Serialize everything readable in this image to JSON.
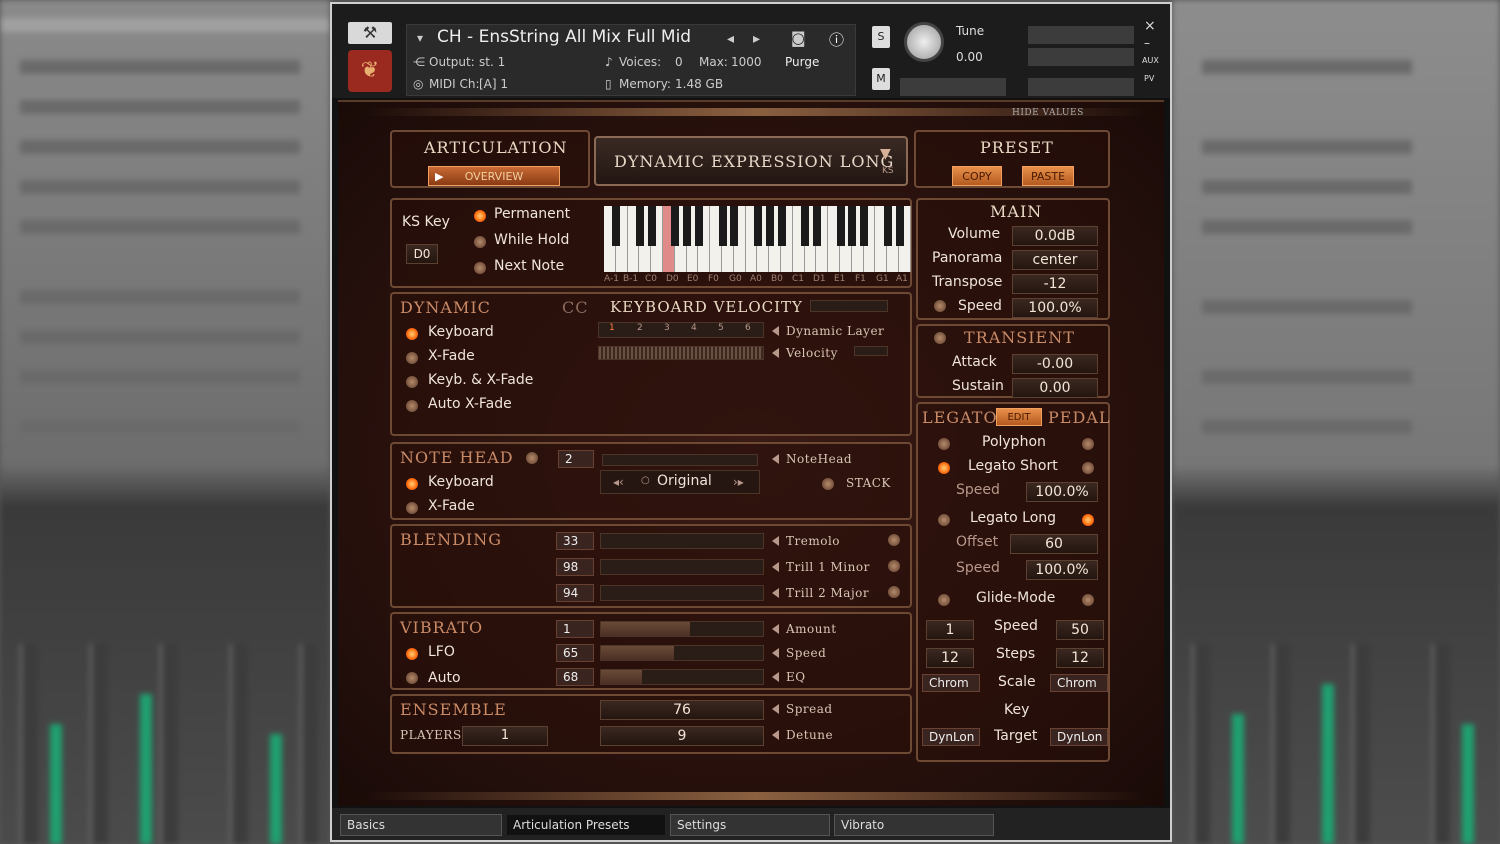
{
  "header": {
    "instrument": "CH - EnsString All Mix Full Mid",
    "output_label": "Output:",
    "output_value": "st. 1",
    "midi_label": "MIDI Ch:",
    "midi_value": "[A]  1",
    "voices_label": "Voices:",
    "voices_value": "0",
    "max_label": "Max:",
    "max_value": "1000",
    "memory_label": "Memory:",
    "memory_value": "1.48 GB",
    "purge": "Purge",
    "tune_label": "Tune",
    "tune_value": "0.00",
    "solo": "S",
    "mute": "M",
    "close": "×",
    "minimize": "–",
    "aux": "AUX",
    "pv": "PV",
    "hide_values": "HIDE VALUES"
  },
  "articulation": {
    "title": "ARTICULATION",
    "overview": "OVERVIEW",
    "current": "DYNAMIC EXPRESSION LONG",
    "ks": "KS"
  },
  "preset": {
    "title": "PRESET",
    "copy": "COPY",
    "paste": "PASTE"
  },
  "ks": {
    "label": "KS Key",
    "key": "D0",
    "modes": [
      "Permanent",
      "While Hold",
      "Next Note"
    ],
    "active": 0
  },
  "keys": {
    "labels": [
      "A-1",
      "B-1",
      "C0",
      "D0",
      "E0",
      "F0",
      "G0",
      "A0",
      "B0",
      "C1",
      "D1",
      "E1",
      "F1",
      "G1",
      "A1"
    ]
  },
  "dynamic": {
    "title": "DYNAMIC",
    "cc": "CC",
    "kv": "KEYBOARD VELOCITY",
    "items": [
      "Keyboard",
      "X-Fade",
      "Keyb. & X-Fade",
      "Auto X-Fade"
    ],
    "active": 0,
    "layers": [
      "1",
      "2",
      "3",
      "4",
      "5",
      "6"
    ],
    "dynamic_layer": "Dynamic Layer",
    "velocity": "Velocity"
  },
  "notehead": {
    "title": "NOTE HEAD",
    "value": "2",
    "items": [
      "Keyboard",
      "X-Fade"
    ],
    "active": 0,
    "label": "NoteHead",
    "selection": "Original",
    "stack": "STACK"
  },
  "blending": {
    "title": "BLENDING",
    "rows": [
      {
        "value": "33",
        "label": "Tremolo"
      },
      {
        "value": "98",
        "label": "Trill 1 Minor"
      },
      {
        "value": "94",
        "label": "Trill 2 Major"
      }
    ]
  },
  "vibrato": {
    "title": "VIBRATO",
    "rows": [
      {
        "value": "1",
        "label": "Amount",
        "fill": 0.55
      },
      {
        "value": "65",
        "label": "Speed",
        "fill": 0.45
      },
      {
        "value": "68",
        "label": "EQ",
        "fill": 0.25
      }
    ],
    "items": [
      "LFO",
      "Auto"
    ],
    "active": 0
  },
  "ensemble": {
    "title": "ENSEMBLE",
    "players_label": "PLAYERS",
    "players": "1",
    "spread": "76",
    "spread_label": "Spread",
    "detune": "9",
    "detune_label": "Detune"
  },
  "mainpanel": {
    "title": "MAIN",
    "rows": [
      {
        "label": "Volume",
        "value": "0.0dB"
      },
      {
        "label": "Panorama",
        "value": "center"
      },
      {
        "label": "Transpose",
        "value": "-12"
      },
      {
        "label": "Speed",
        "value": "100.0%"
      }
    ]
  },
  "transient": {
    "title": "TRANSIENT",
    "rows": [
      {
        "label": "Attack",
        "value": "-0.00"
      },
      {
        "label": "Sustain",
        "value": "0.00"
      }
    ]
  },
  "legato": {
    "title": "LEGATO",
    "edit": "EDIT",
    "pedal": "PEDAL",
    "polyphon": "Polyphon",
    "short": "Legato Short",
    "short_speed_label": "Speed",
    "short_speed": "100.0%",
    "long": "Legato Long",
    "offset_label": "Offset",
    "offset": "60",
    "long_speed_label": "Speed",
    "long_speed": "100.0%",
    "glide": "Glide-Mode",
    "speed_label": "Speed",
    "speed_l": "1",
    "speed_r": "50",
    "steps_label": "Steps",
    "steps_l": "12",
    "steps_r": "12",
    "scale_label": "Scale",
    "scale_l": "Chrom",
    "scale_r": "Chrom",
    "key_label": "Key",
    "target_label": "Target",
    "target_l": "DynLon",
    "target_r": "DynLon"
  },
  "tabs": [
    "Basics",
    "Articulation Presets",
    "Settings",
    "Vibrato"
  ],
  "active_tab": 1
}
